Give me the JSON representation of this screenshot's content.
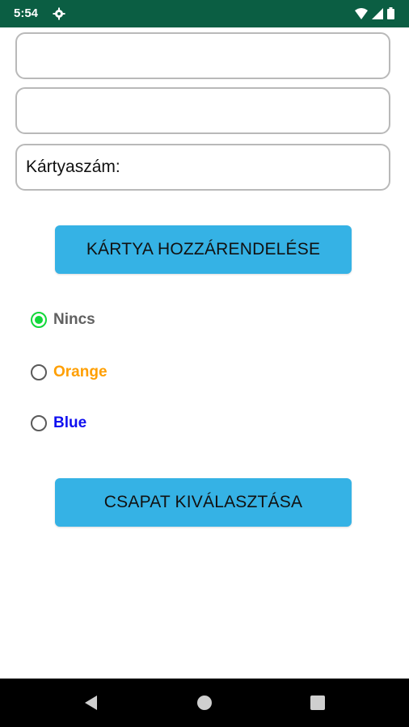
{
  "status_bar": {
    "time": "5:54",
    "icons": [
      "gear-icon",
      "wifi-icon",
      "signal-icon",
      "battery-icon"
    ]
  },
  "fields": [
    {
      "label": "",
      "value": ""
    },
    {
      "label": "",
      "value": ""
    },
    {
      "label": "Kártyaszám:",
      "value": ""
    }
  ],
  "buttons": {
    "assign_card": "KÁRTYA HOZZÁRENDELÉSE",
    "select_team": "CSAPAT KIVÁLASZTÁSA"
  },
  "radio_options": [
    {
      "label": "Nincs",
      "color": "#616161",
      "checked": true
    },
    {
      "label": "Orange",
      "color": "#ff9f00",
      "checked": false
    },
    {
      "label": "Blue",
      "color": "#1010f0",
      "checked": false
    }
  ],
  "colors": {
    "status_bar": "#0b5e43",
    "button": "#35b2e5",
    "radio_checked": "#12d83a"
  },
  "nav_bar": {
    "icons": [
      "back-icon",
      "home-icon",
      "recents-icon"
    ]
  }
}
